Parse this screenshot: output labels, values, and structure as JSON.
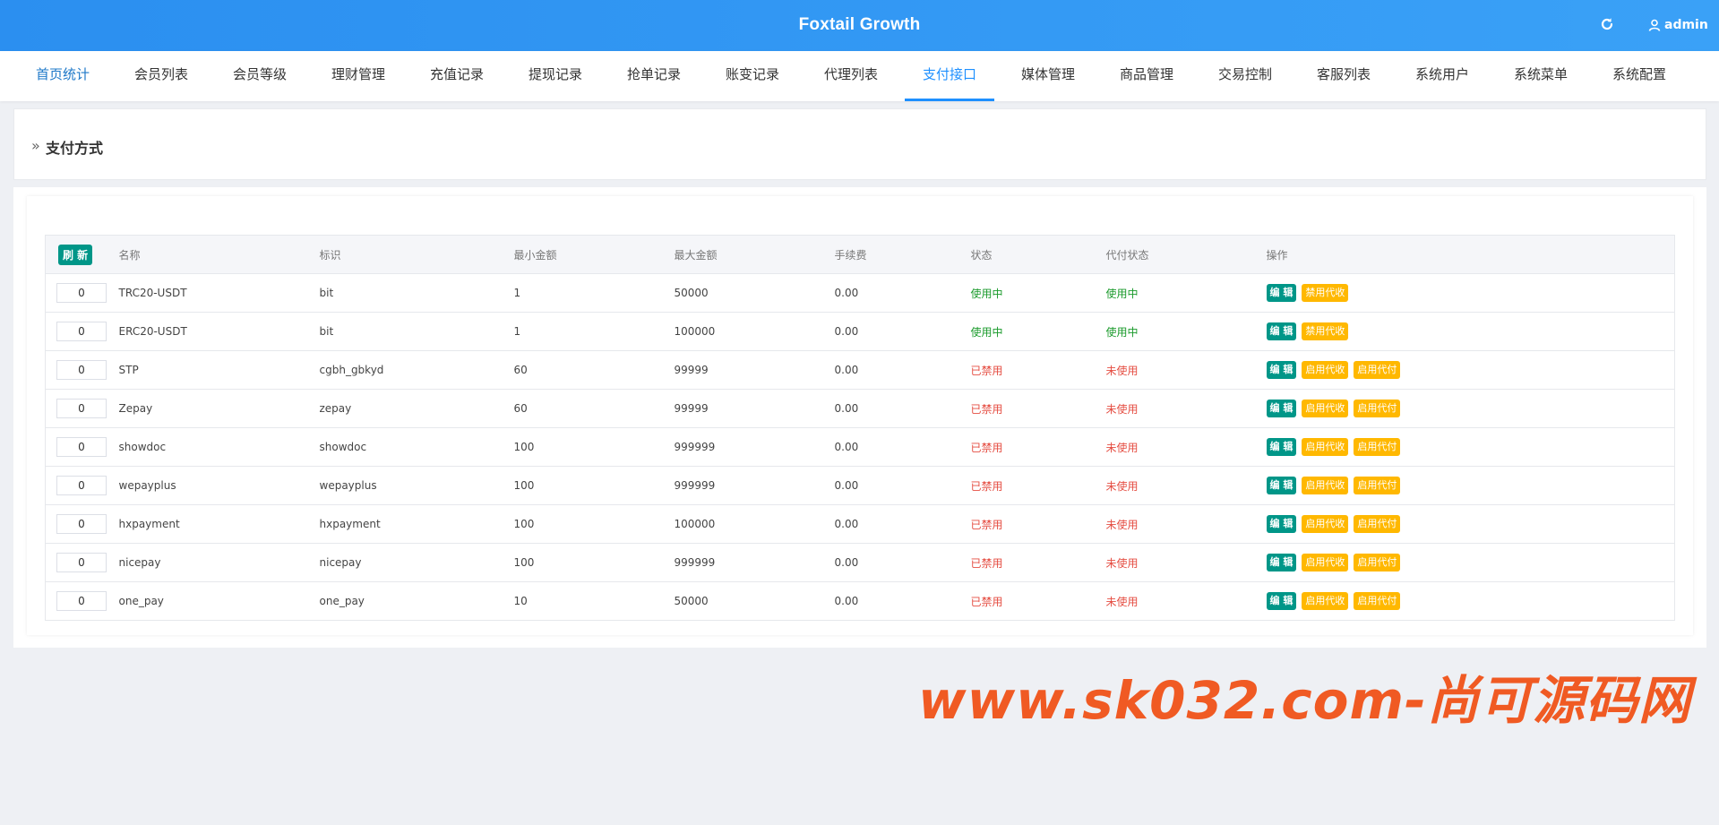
{
  "header": {
    "title": "Foxtail Growth",
    "user": "admin"
  },
  "nav": {
    "tabs": [
      "首页统计",
      "会员列表",
      "会员等级",
      "理财管理",
      "充值记录",
      "提现记录",
      "抢单记录",
      "账变记录",
      "代理列表",
      "支付接口",
      "媒体管理",
      "商品管理",
      "交易控制",
      "客服列表",
      "系统用户",
      "系统菜单",
      "系统配置"
    ],
    "active": "支付接口"
  },
  "page": {
    "title": "支付方式"
  },
  "table": {
    "refresh_label": "刷 新",
    "headers": [
      "名称",
      "标识",
      "最小金额",
      "最大金额",
      "手续费",
      "状态",
      "代付状态",
      "操作"
    ],
    "rows": [
      {
        "sort": "0",
        "name": "TRC20-USDT",
        "code": "bit",
        "min": "1",
        "max": "50000",
        "fee": "0.00",
        "status": "使用中",
        "payout": "使用中",
        "actions": [
          "编 辑",
          "禁用代收"
        ]
      },
      {
        "sort": "0",
        "name": "ERC20-USDT",
        "code": "bit",
        "min": "1",
        "max": "100000",
        "fee": "0.00",
        "status": "使用中",
        "payout": "使用中",
        "actions": [
          "编 辑",
          "禁用代收"
        ]
      },
      {
        "sort": "0",
        "name": "STP",
        "code": "cgbh_gbkyd",
        "min": "60",
        "max": "99999",
        "fee": "0.00",
        "status": "已禁用",
        "payout": "未使用",
        "actions": [
          "编 辑",
          "启用代收",
          "启用代付"
        ]
      },
      {
        "sort": "0",
        "name": "Zepay",
        "code": "zepay",
        "min": "60",
        "max": "99999",
        "fee": "0.00",
        "status": "已禁用",
        "payout": "未使用",
        "actions": [
          "编 辑",
          "启用代收",
          "启用代付"
        ]
      },
      {
        "sort": "0",
        "name": "showdoc",
        "code": "showdoc",
        "min": "100",
        "max": "999999",
        "fee": "0.00",
        "status": "已禁用",
        "payout": "未使用",
        "actions": [
          "编 辑",
          "启用代收",
          "启用代付"
        ]
      },
      {
        "sort": "0",
        "name": "wepayplus",
        "code": "wepayplus",
        "min": "100",
        "max": "999999",
        "fee": "0.00",
        "status": "已禁用",
        "payout": "未使用",
        "actions": [
          "编 辑",
          "启用代收",
          "启用代付"
        ]
      },
      {
        "sort": "0",
        "name": "hxpayment",
        "code": "hxpayment",
        "min": "100",
        "max": "100000",
        "fee": "0.00",
        "status": "已禁用",
        "payout": "未使用",
        "actions": [
          "编 辑",
          "启用代收",
          "启用代付"
        ]
      },
      {
        "sort": "0",
        "name": "nicepay",
        "code": "nicepay",
        "min": "100",
        "max": "999999",
        "fee": "0.00",
        "status": "已禁用",
        "payout": "未使用",
        "actions": [
          "编 辑",
          "启用代收",
          "启用代付"
        ]
      },
      {
        "sort": "0",
        "name": "one_pay",
        "code": "one_pay",
        "min": "10",
        "max": "50000",
        "fee": "0.00",
        "status": "已禁用",
        "payout": "未使用",
        "actions": [
          "编 辑",
          "启用代收",
          "启用代付"
        ]
      }
    ]
  },
  "watermark": "www.sk032.com-尚可源码网",
  "colors": {
    "header": "#2b8ff0",
    "accent": "#1e90ff",
    "edit": "#009688",
    "warn": "#ffb800",
    "active_status": "#1a9a2b",
    "disabled_status": "#e54d42",
    "watermark": "#f05a23"
  },
  "icons": {
    "refresh": "refresh-icon",
    "user": "user-icon",
    "chevron": "double-chevron-right-icon"
  }
}
